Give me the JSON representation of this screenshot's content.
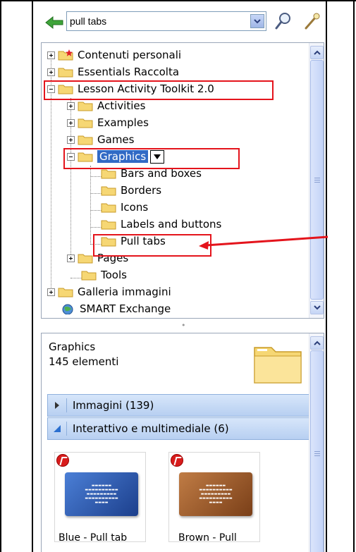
{
  "toolbar": {
    "search_value": "pull tabs"
  },
  "tree": {
    "items": [
      {
        "label": "Contenuti personali"
      },
      {
        "label": "Essentials Raccolta"
      },
      {
        "label": "Lesson Activity Toolkit 2.0"
      },
      {
        "label": "Activities"
      },
      {
        "label": "Examples"
      },
      {
        "label": "Games"
      },
      {
        "label": "Graphics"
      },
      {
        "label": "Bars and boxes"
      },
      {
        "label": "Borders"
      },
      {
        "label": "Icons"
      },
      {
        "label": "Labels and buttons"
      },
      {
        "label": "Pull tabs"
      },
      {
        "label": "Pages"
      },
      {
        "label": "Tools"
      },
      {
        "label": "Galleria immagini"
      },
      {
        "label": "SMART Exchange"
      }
    ]
  },
  "details": {
    "title": "Graphics",
    "count": "145 elementi",
    "sections": [
      {
        "label": "Immagini (139)",
        "expanded": false
      },
      {
        "label": "Interattivo e multimediale (6)",
        "expanded": true
      }
    ],
    "items": [
      {
        "caption": "Blue - Pull tab",
        "color": "#2f5fb0"
      },
      {
        "caption": "Brown - Pull",
        "color": "#a8612f"
      }
    ]
  },
  "colors": {
    "highlight_box": "#e4141c",
    "selection": "#316ac5",
    "folder": "#f6d774"
  }
}
